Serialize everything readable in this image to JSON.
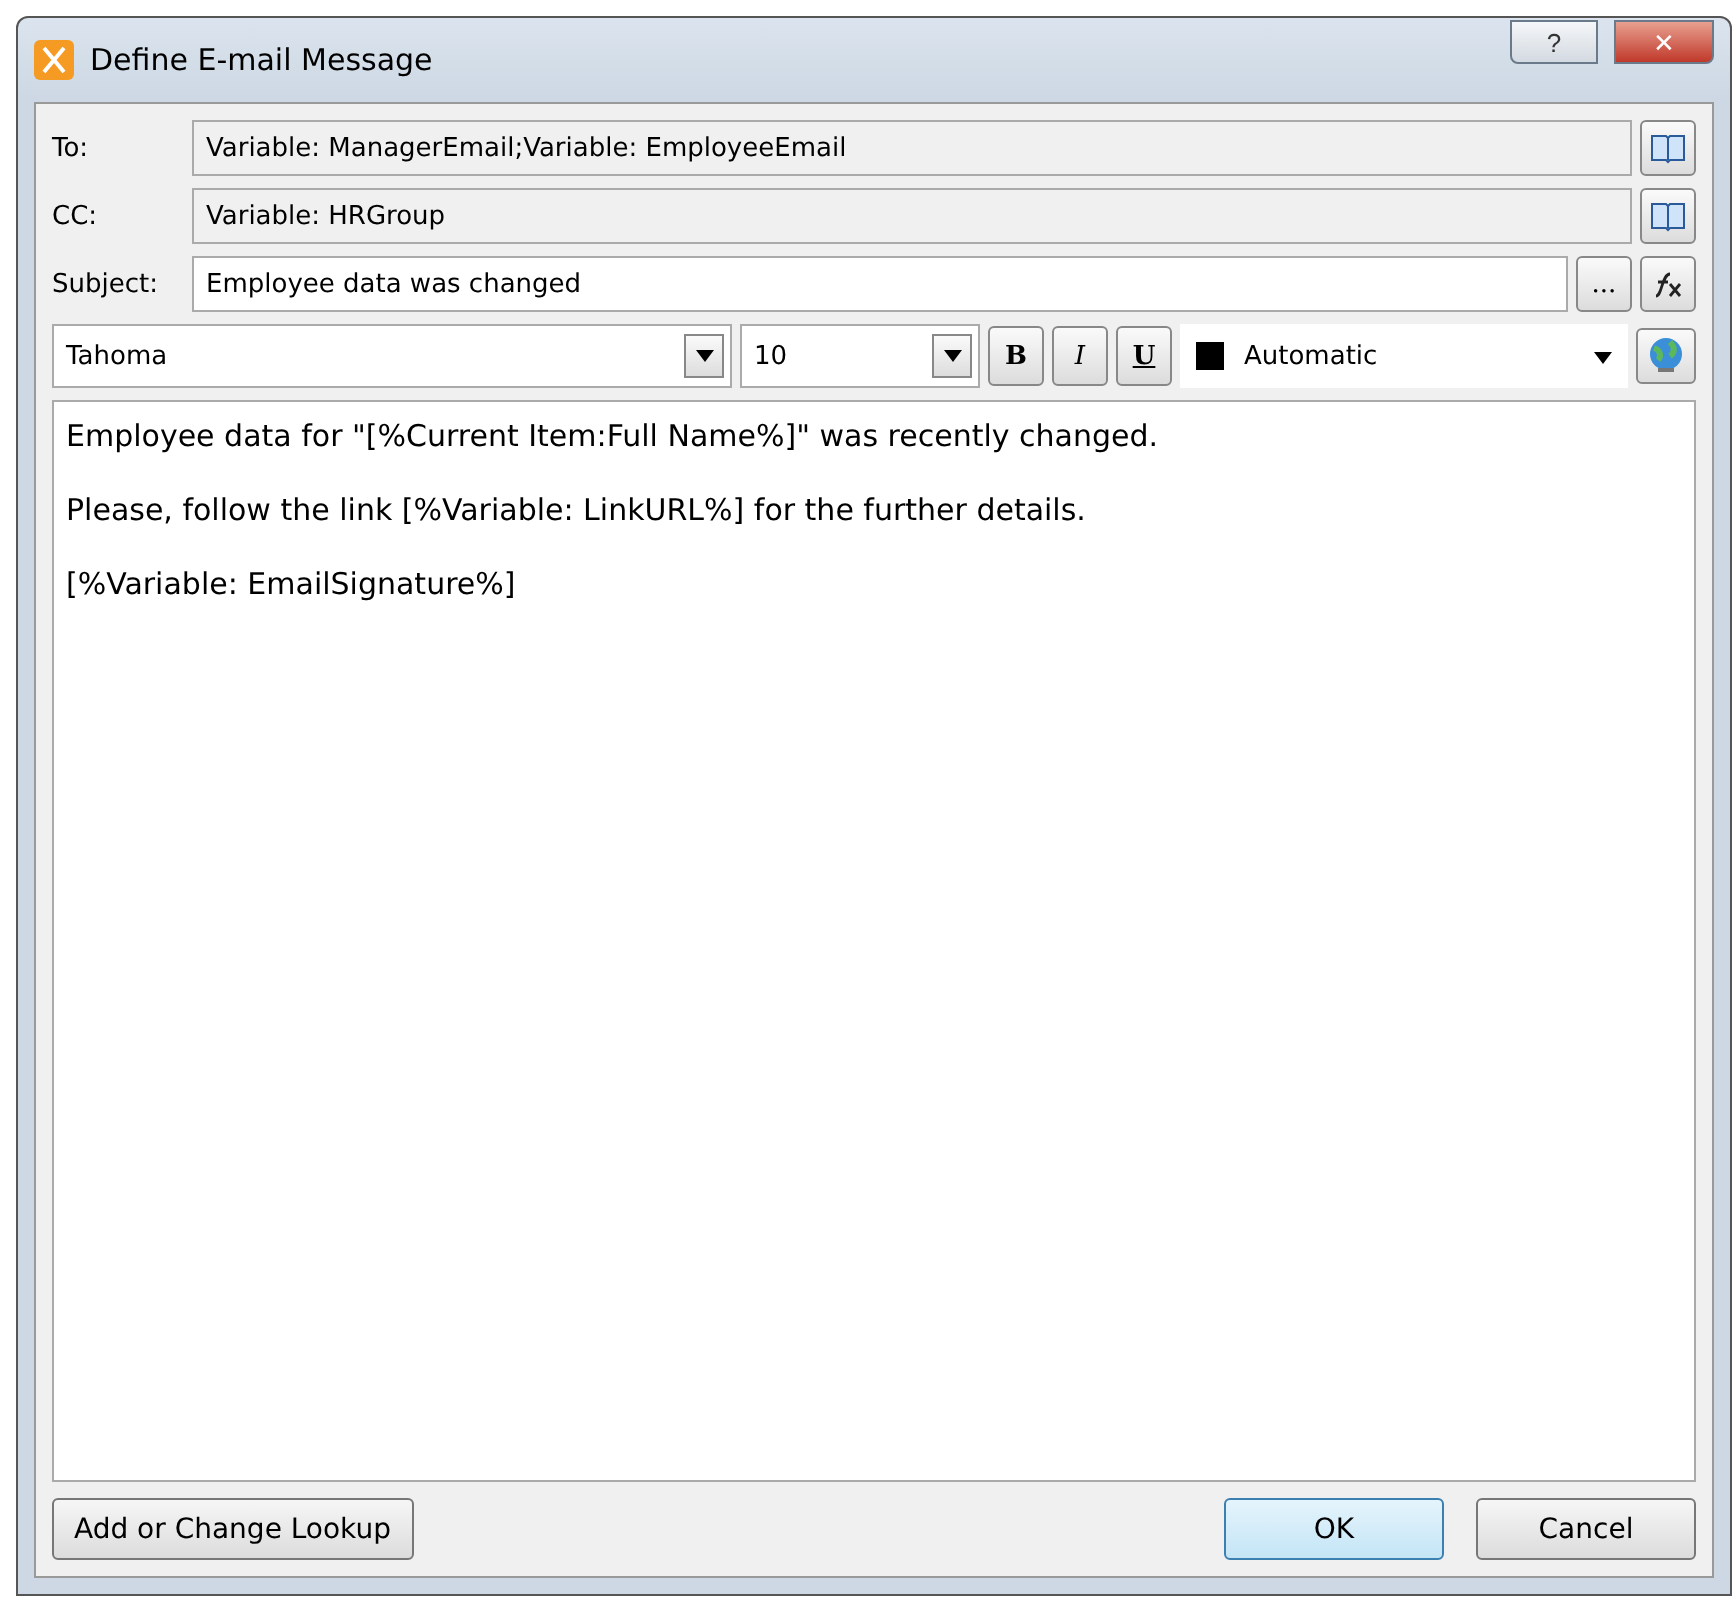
{
  "window": {
    "title": "Define E-mail Message",
    "help": "?",
    "close": "✕"
  },
  "fields": [
    {
      "label": "To:",
      "value": "Variable: ManagerEmail;Variable: EmployeeEmail",
      "readonly": true,
      "buttons": [
        {
          "kind": "book"
        }
      ]
    },
    {
      "label": "CC:",
      "value": "Variable: HRGroup",
      "readonly": true,
      "buttons": [
        {
          "kind": "book"
        }
      ]
    },
    {
      "label": "Subject:",
      "value": "Employee data was changed",
      "readonly": false,
      "buttons": [
        {
          "kind": "text",
          "text": "..."
        },
        {
          "kind": "fx"
        }
      ]
    }
  ],
  "toolbar": {
    "font": "Tahoma",
    "size": "10",
    "bold": "B",
    "italic": "I",
    "underline": "U",
    "color_label": "Automatic",
    "color": "#000000"
  },
  "body": [
    "Employee data for \"[%Current Item:Full Name%]\" was recently changed.",
    "Please, follow the link [%Variable: LinkURL%]  for the further details.",
    "[%Variable: EmailSignature%]"
  ],
  "buttons": {
    "lookup": "Add or Change Lookup",
    "ok": "OK",
    "cancel": "Cancel"
  }
}
